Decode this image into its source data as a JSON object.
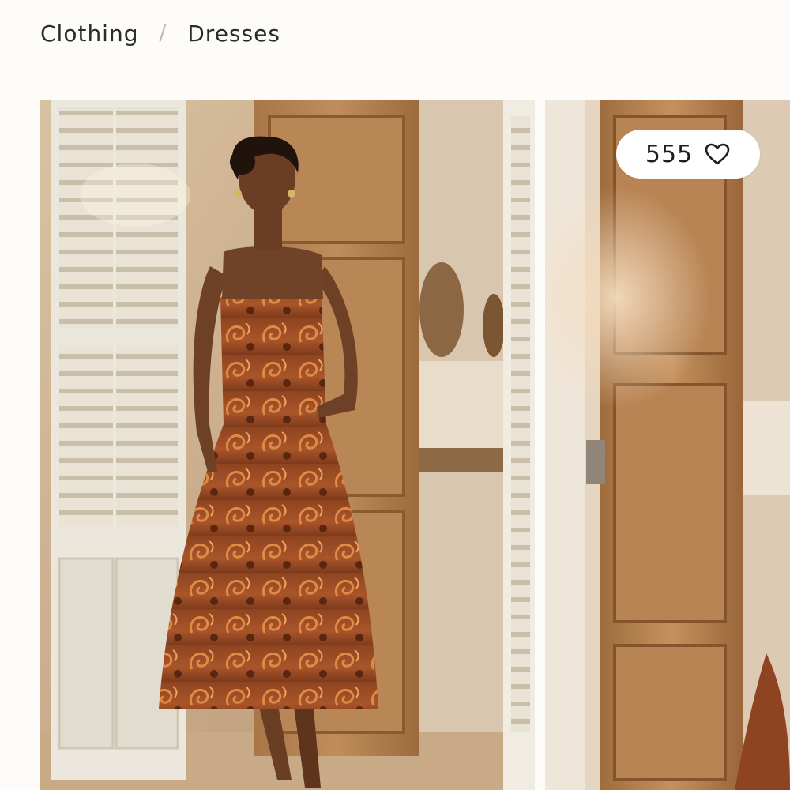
{
  "breadcrumb": {
    "items": [
      {
        "label": "Clothing"
      },
      {
        "label": "Dresses"
      }
    ],
    "separator": "/"
  },
  "product": {
    "like_count": "555",
    "like_icon": "heart-outline-icon",
    "images": [
      {
        "subject": "model-in-paisley-midi-dress"
      },
      {
        "subject": "wooden-door-detail"
      }
    ]
  },
  "colors": {
    "background": "#fdfcf9",
    "text": "#2b2b2b",
    "separator": "#b9b6b1",
    "dress_rust": "#9a4a22"
  }
}
